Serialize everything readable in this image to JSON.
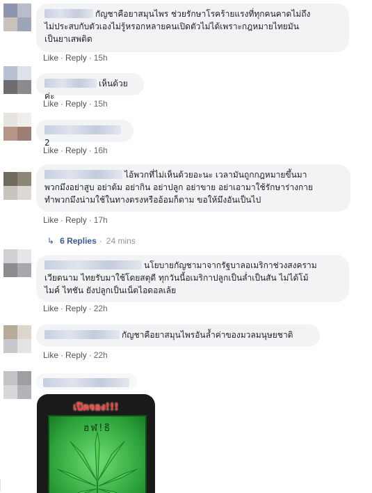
{
  "actions": {
    "like": "Like",
    "reply": "Reply",
    "separator": "·"
  },
  "comments": [
    {
      "lines": [
        "กัญชาคือยาสมุนไพร ช่วยรักษาโรคร้ายแรงที่ทุกคนคาดไม่ถึง",
        "ไม่ประสบกับตัวเองไม่รู้หรอกหลายคนเปิดตัวไม่ได้เพราะกฎหมายไทยมัน",
        "เป็นยาเสพติด"
      ],
      "time": "15h",
      "avatar_colors": [
        "#8d96ae",
        "#b8bccb",
        "#c9c3bb",
        "#9da6b8"
      ]
    },
    {
      "lines": [
        "เห็นด้วยค่ะ"
      ],
      "time": "15h",
      "avatar_colors": [
        "#b9c0d2",
        "#dfe2ea",
        "#6f6b70",
        "#8d8a8f"
      ]
    },
    {
      "lines": [
        "2"
      ],
      "time": "16h",
      "avatar_colors": [
        "#e7e3df",
        "#f0eeec",
        "#b59585",
        "#9c7e72"
      ]
    },
    {
      "lines": [
        "ไอ้พวกที่ไม่เห็นด้วยอะนะ เวลามันถูกกฎหมายขึ้นมา",
        "พวกมึงอย่าสูบ อย่าต้ม อย่ากิน อย่าปลูก อย่าขาย อย่าเอามาใช้รักษาร่างกาย",
        "ทำพวกมึงน่ามใช้ในทางตรงหรืออ้อมก็ตาม ขอให้มึงอันเป็นไป"
      ],
      "time": "17h",
      "avatar_colors": [
        "#6e6a5f",
        "#8c8677",
        "#c8c4bd",
        "#dcd9d4"
      ]
    },
    {
      "lines": [
        "นโยบายกัญชามาจากรัฐบาลอเมริกาช่วงสงคราม",
        "เวียดนาม ไทยรับมาใช้โดยสตุดี ทุกวันนี้อเมริกาปลูกเป็นล่ำเป็นสัน ไม่ได้โม้",
        "ไมค์ ไทชัน ยังปลูกเป็นเน็ตไอดอลเล้ย"
      ],
      "time": "22h",
      "avatar_colors": [
        "#cfd0d4",
        "#e6e6e8",
        "#8b8c90",
        "#a7a8ac"
      ]
    },
    {
      "lines": [
        "กัญชาคือยาสมุนไพรอันล้ำค่าของมวลมนุษยชาติ"
      ],
      "time": "22h",
      "avatar_colors": [
        "#b7ab98",
        "#dcd6cd",
        "#c8c9cd",
        "#e4e4e6"
      ]
    }
  ],
  "thread": {
    "replies_label": "6 Replies",
    "time": "24 mins",
    "icon": "reply-arrow-icon"
  },
  "last_comment": {
    "avatar_colors": [
      "#c3c3c6",
      "#9f9fa3",
      "#d8d8da",
      "#b4b4b8"
    ],
    "image_caption": "เปิดจอง!!!",
    "image_card_text": "ฮฬ!ธิ"
  }
}
